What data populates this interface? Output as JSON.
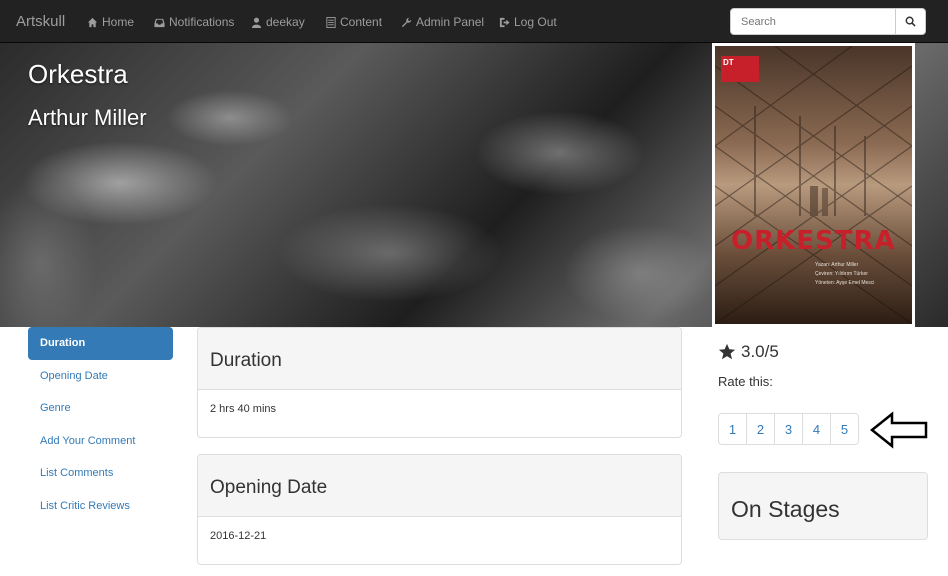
{
  "navbar": {
    "brand": "Artskull",
    "items": [
      {
        "label": "Home",
        "icon": "home-icon"
      },
      {
        "label": "Notifications",
        "icon": "inbox-icon"
      },
      {
        "label": "deekay",
        "icon": "user-icon"
      },
      {
        "label": "Content",
        "icon": "list-icon"
      },
      {
        "label": "Admin Panel",
        "icon": "wrench-icon"
      },
      {
        "label": "Log Out",
        "icon": "logout-icon"
      }
    ],
    "search_placeholder": "Search"
  },
  "hero": {
    "title": "Orkestra",
    "subtitle": "Arthur Miller"
  },
  "poster": {
    "logo_text": "DT",
    "title": "ORKESTRA",
    "credits": [
      "Yazan: Arthur Miller",
      "Çeviren: Yıldırım Türker",
      "Yöneten: Ayşe Emel Mesci"
    ]
  },
  "sidebar": {
    "items": [
      {
        "label": "Duration",
        "active": true
      },
      {
        "label": "Opening Date",
        "active": false
      },
      {
        "label": "Genre",
        "active": false
      },
      {
        "label": "Add Your Comment",
        "active": false
      },
      {
        "label": "List Comments",
        "active": false
      },
      {
        "label": "List Critic Reviews",
        "active": false
      }
    ]
  },
  "panels": [
    {
      "heading": "Duration",
      "body": "2 hrs 40 mins"
    },
    {
      "heading": "Opening Date",
      "body": "2016-12-21"
    }
  ],
  "rating": {
    "score": "3.0/5",
    "label": "Rate this:",
    "options": [
      "1",
      "2",
      "3",
      "4",
      "5"
    ]
  },
  "on_stages": {
    "title": "On Stages"
  },
  "colors": {
    "navbar_bg": "#222222",
    "nav_text": "#9d9d9d",
    "link": "#337ab7",
    "active_bg": "#337ab7",
    "poster_title": "#c8202a"
  }
}
